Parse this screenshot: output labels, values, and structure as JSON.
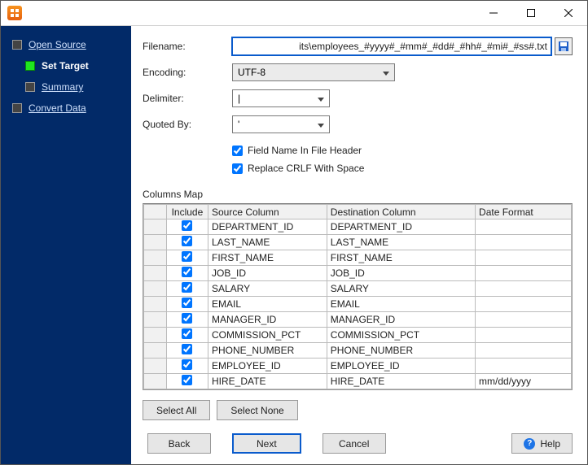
{
  "sidebar": {
    "items": [
      {
        "label": "Open Source"
      },
      {
        "label": "Set Target"
      },
      {
        "label": "Summary"
      },
      {
        "label": "Convert Data"
      }
    ]
  },
  "form": {
    "filenameLabel": "Filename:",
    "filenameValue": "its\\employees_#yyyy#_#mm#_#dd#_#hh#_#mi#_#ss#.txt",
    "encodingLabel": "Encoding:",
    "encodingValue": "UTF-8",
    "delimiterLabel": "Delimiter:",
    "delimiterValue": "|",
    "quotedByLabel": "Quoted By:",
    "quotedByValue": "'",
    "fieldNameHeader": "Field Name In File Header",
    "replaceCrlf": "Replace CRLF With Space"
  },
  "columnsMapLabel": "Columns Map",
  "tableHeaders": {
    "include": "Include",
    "src": "Source Column",
    "dst": "Destination Column",
    "fmt": "Date Format"
  },
  "rows": [
    {
      "src": "DEPARTMENT_ID",
      "dst": "DEPARTMENT_ID",
      "fmt": ""
    },
    {
      "src": "LAST_NAME",
      "dst": "LAST_NAME",
      "fmt": ""
    },
    {
      "src": "FIRST_NAME",
      "dst": "FIRST_NAME",
      "fmt": ""
    },
    {
      "src": "JOB_ID",
      "dst": "JOB_ID",
      "fmt": ""
    },
    {
      "src": "SALARY",
      "dst": "SALARY",
      "fmt": ""
    },
    {
      "src": "EMAIL",
      "dst": "EMAIL",
      "fmt": ""
    },
    {
      "src": "MANAGER_ID",
      "dst": "MANAGER_ID",
      "fmt": ""
    },
    {
      "src": "COMMISSION_PCT",
      "dst": "COMMISSION_PCT",
      "fmt": ""
    },
    {
      "src": "PHONE_NUMBER",
      "dst": "PHONE_NUMBER",
      "fmt": ""
    },
    {
      "src": "EMPLOYEE_ID",
      "dst": "EMPLOYEE_ID",
      "fmt": ""
    },
    {
      "src": "HIRE_DATE",
      "dst": "HIRE_DATE",
      "fmt": "mm/dd/yyyy"
    }
  ],
  "buttons": {
    "selectAll": "Select All",
    "selectNone": "Select None",
    "back": "Back",
    "next": "Next",
    "cancel": "Cancel",
    "help": "Help"
  }
}
